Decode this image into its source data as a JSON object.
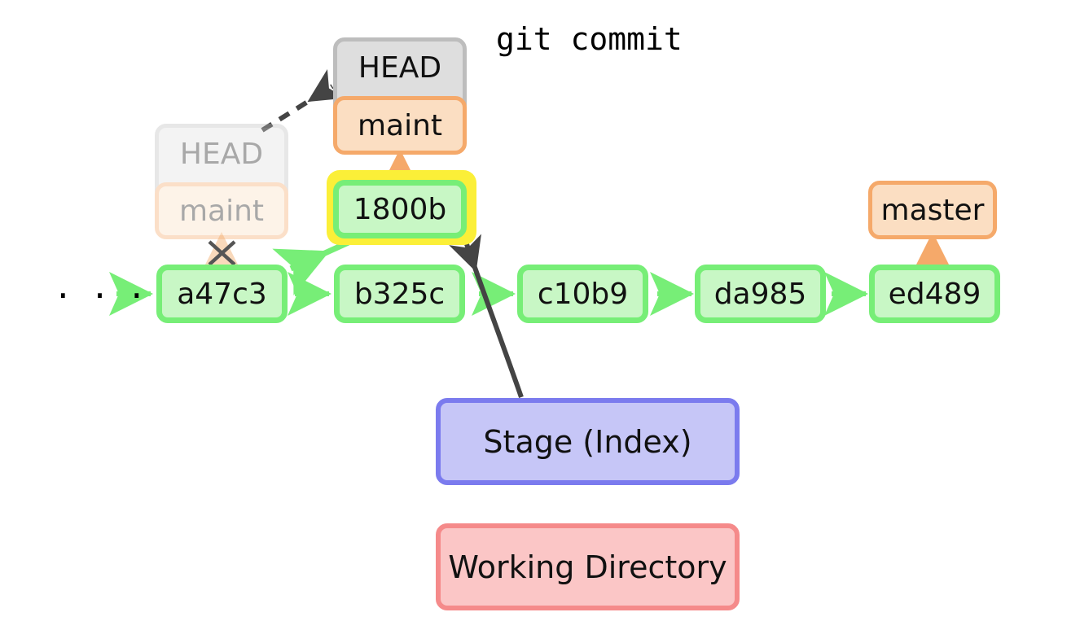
{
  "diagram": {
    "title": "git commit",
    "ellipsis": "· · ·",
    "colors": {
      "commit_fill": "#c8f7c5",
      "commit_border": "#77ee77",
      "ref_fill": "#fbdec2",
      "ref_border": "#f5a96a",
      "head_fill": "#dedede",
      "head_border": "#bdbdbd",
      "stage_fill": "#c6c6f7",
      "stage_border": "#7b7bee",
      "work_fill": "#fbc6c6",
      "work_border": "#f58a8a",
      "highlight": "#fbef38",
      "arrow_dark": "#444444"
    },
    "commits": [
      {
        "id": "a47c3"
      },
      {
        "id": "b325c"
      },
      {
        "id": "c10b9"
      },
      {
        "id": "da985"
      },
      {
        "id": "ed489"
      }
    ],
    "new_commit": {
      "id": "1800b",
      "highlighted": true
    },
    "refs": {
      "head_label": "HEAD",
      "maint_label": "maint",
      "master_label": "master",
      "old_head_label": "HEAD",
      "old_maint_label": "maint"
    },
    "areas": {
      "stage": "Stage (Index)",
      "working_directory": "Working Directory"
    }
  }
}
